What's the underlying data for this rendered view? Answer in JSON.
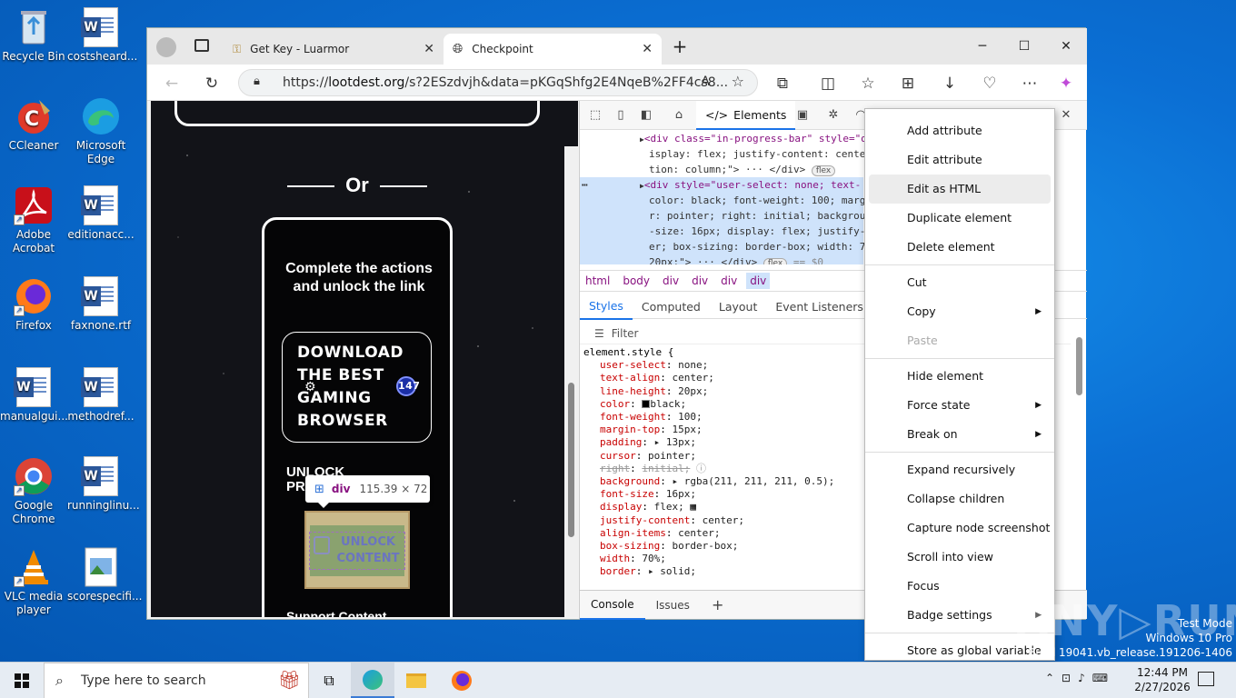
{
  "desktop": {
    "icons": [
      {
        "label": "Recycle Bin"
      },
      {
        "label": "costsheard..."
      },
      {
        "label": "CCleaner"
      },
      {
        "label": "Microsoft Edge"
      },
      {
        "label": "Adobe Acrobat"
      },
      {
        "label": "editionacc..."
      },
      {
        "label": "Firefox"
      },
      {
        "label": "faxnone.rtf"
      },
      {
        "label": "manualgui..."
      },
      {
        "label": "methodref..."
      },
      {
        "label": "Google Chrome"
      },
      {
        "label": "runninglinu..."
      },
      {
        "label": "VLC media player"
      },
      {
        "label": "scorespecifi..."
      }
    ]
  },
  "browser": {
    "tabs": [
      {
        "title": "Get Key - Luarmor"
      },
      {
        "title": "Checkpoint"
      }
    ],
    "new_tab": "+",
    "window_controls": {
      "minimize": "─",
      "maximize": "☐",
      "close": "✕"
    },
    "url_prefix": "https://",
    "url_domain": "lootdest.org",
    "url_rest": "/s?2ESzdvjh&data=pKGqShfg2E4NqeB%2FF4cs8..."
  },
  "page": {
    "or_label": "Or",
    "card_title": "Complete the actions and unlock the link",
    "download_button": "DOWNLOAD THE BEST GAMING BROWSER",
    "badge_count": "147",
    "unlock_partial": "UNLOCK\nPR",
    "unlock_content": "UNLOCK CONTENT",
    "support_content": "Support Content",
    "tooltip_tag": "div",
    "tooltip_size": "115.39 × 72"
  },
  "devtools": {
    "active_panel": "Elements",
    "dom_lines": [
      {
        "l1": "<div class=\"in-progress-bar\" style=\"d",
        "l2": "isplay: flex; justify-content: cente",
        "l3": "tion: column;\"> ··· </div>"
      },
      {
        "l1": "<div style=\"user-select: none; text-",
        "l2": "color: black; font-weight: 100; marg",
        "l3": "r: pointer; right: initial; backgrou",
        "l4": "-size: 16px; display: flex; justify-",
        "l5": "er; box-sizing: border-box; width: 70",
        "l6": "20px;\"> ··· </div>"
      }
    ],
    "dom_right_fragments": [
      "d",
      "ec",
      "so",
      "nt",
      "nt",
      ":"
    ],
    "flex_badge": "flex",
    "eq_dollar": "== $0",
    "breadcrumbs": [
      "html",
      "body",
      "div",
      "div",
      "div",
      "div"
    ],
    "subtabs": [
      "Styles",
      "Computed",
      "Layout",
      "Event Listeners",
      "DC"
    ],
    "filter_placeholder": "Filter",
    "element_style": "element.style {",
    "css_props": [
      {
        "name": "user-select",
        "value": "none;"
      },
      {
        "name": "text-align",
        "value": "center;"
      },
      {
        "name": "line-height",
        "value": "20px;"
      },
      {
        "name": "color",
        "value": "black;"
      },
      {
        "name": "font-weight",
        "value": "100;"
      },
      {
        "name": "margin-top",
        "value": "15px;"
      },
      {
        "name": "padding",
        "value": "▸ 13px;"
      },
      {
        "name": "cursor",
        "value": "pointer;"
      },
      {
        "name": "right",
        "value": "initial;"
      },
      {
        "name": "background",
        "value": "▸ rgba(211, 211, 211, 0.5);"
      },
      {
        "name": "font-size",
        "value": "16px;"
      },
      {
        "name": "display",
        "value": "flex;"
      },
      {
        "name": "justify-content",
        "value": "center;"
      },
      {
        "name": "align-items",
        "value": "center;"
      },
      {
        "name": "box-sizing",
        "value": "border-box;"
      },
      {
        "name": "width",
        "value": "70%;"
      },
      {
        "name": "border",
        "value": "▸ solid;"
      }
    ],
    "drawer_tabs": [
      "Console",
      "Issues"
    ]
  },
  "context_menu": {
    "items": [
      {
        "label": "Add attribute"
      },
      {
        "label": "Edit attribute"
      },
      {
        "label": "Edit as HTML"
      },
      {
        "label": "Duplicate element"
      },
      {
        "label": "Delete element"
      },
      {
        "label": "Cut"
      },
      {
        "label": "Copy"
      },
      {
        "label": "Paste"
      },
      {
        "label": "Hide element"
      },
      {
        "label": "Force state"
      },
      {
        "label": "Break on"
      },
      {
        "label": "Expand recursively"
      },
      {
        "label": "Collapse children"
      },
      {
        "label": "Capture node screenshot"
      },
      {
        "label": "Scroll into view"
      },
      {
        "label": "Focus"
      },
      {
        "label": "Badge settings"
      },
      {
        "label": "Store as global variable"
      }
    ]
  },
  "taskbar": {
    "search_placeholder": "Type here to search",
    "time": "12:44 PM",
    "date": "2/27/2026"
  },
  "watermark": {
    "line1": "Test Mode",
    "line2": "Windows 10 Pro",
    "line3": "Build 19041.vb_release.191206-1406",
    "brand": "ANY▷RUN"
  }
}
